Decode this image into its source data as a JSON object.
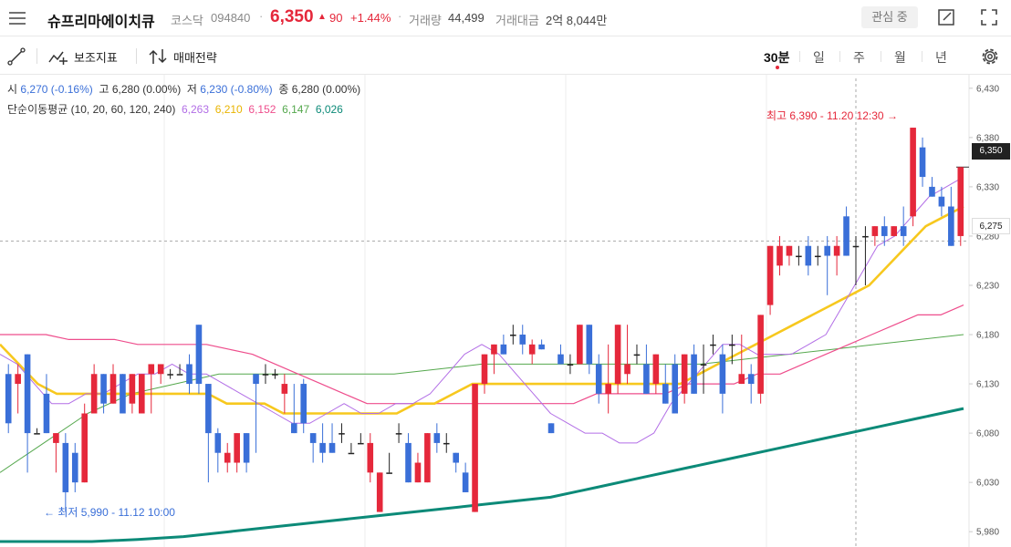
{
  "header": {
    "stock_name": "슈프리마에이치큐",
    "market": "코스닥",
    "code": "094840",
    "price": "6,350",
    "change_arrow": "▲",
    "change": "90",
    "change_pct": "+1.44%",
    "volume_label": "거래량",
    "volume": "44,499",
    "amount_label": "거래대금",
    "amount": "2억 8,044만",
    "watch_button": "관심 중"
  },
  "toolbar": {
    "indicator_label": "보조지표",
    "strategy_label": "매매전략",
    "periods": [
      "30분",
      "일",
      "주",
      "월",
      "년"
    ],
    "active_period": "30분"
  },
  "legend": {
    "open_label": "시",
    "open": "6,270 (-0.16%)",
    "high_label": "고",
    "high": "6,280 (0.00%)",
    "low_label": "저",
    "low": "6,230 (-0.80%)",
    "close_label": "종",
    "close": "6,280 (0.00%)",
    "ma_label": "단순이동평균 (10, 20, 60, 120, 240)",
    "ma10": "6,263",
    "ma20": "6,210",
    "ma60": "6,152",
    "ma120": "6,147",
    "ma240": "6,026"
  },
  "colors": {
    "up": "#e5283b",
    "down": "#3a6fd8",
    "ma10": "#b26ee6",
    "ma20": "#f7c81e",
    "ma60": "#ee4d8c",
    "ma120": "#55a84d",
    "ma240": "#0c8a78"
  },
  "annotations": {
    "high": "최고 6,390 - 11.20 12:30 →",
    "low": "← 최저 5,990 - 11.12 10:00"
  },
  "price_tags": {
    "current": "6,350",
    "crosshair": "6,275"
  },
  "chart_data": {
    "type": "candlestick",
    "y_axis_ticks": [
      "6,430",
      "6,380",
      "6,330",
      "6,280",
      "6,230",
      "6,180",
      "6,130",
      "6,080",
      "6,030",
      "5,980"
    ],
    "ylim": [
      5970,
      6440
    ],
    "candles": [
      {
        "o": 6140,
        "h": 6150,
        "l": 6080,
        "c": 6090
      },
      {
        "o": 6130,
        "h": 6150,
        "l": 6100,
        "c": 6140
      },
      {
        "o": 6160,
        "h": 6160,
        "l": 6040,
        "c": 6080
      },
      {
        "o": 6080,
        "h": 6085,
        "l": 6080,
        "c": 6080
      },
      {
        "o": 6120,
        "h": 6140,
        "l": 6080,
        "c": 6080
      },
      {
        "o": 6070,
        "h": 6080,
        "l": 6040,
        "c": 6080
      },
      {
        "o": 6070,
        "h": 6080,
        "l": 6000,
        "c": 6020
      },
      {
        "o": 6060,
        "h": 6070,
        "l": 6020,
        "c": 6030
      },
      {
        "o": 6030,
        "h": 6110,
        "l": 6030,
        "c": 6100
      },
      {
        "o": 6100,
        "h": 6150,
        "l": 6100,
        "c": 6140
      },
      {
        "o": 6140,
        "h": 6140,
        "l": 6100,
        "c": 6110
      },
      {
        "o": 6110,
        "h": 6150,
        "l": 6110,
        "c": 6140
      },
      {
        "o": 6140,
        "h": 6140,
        "l": 6100,
        "c": 6100
      },
      {
        "o": 6110,
        "h": 6140,
        "l": 6100,
        "c": 6140
      },
      {
        "o": 6100,
        "h": 6140,
        "l": 6100,
        "c": 6140
      },
      {
        "o": 6140,
        "h": 6150,
        "l": 6100,
        "c": 6150
      },
      {
        "o": 6140,
        "h": 6150,
        "l": 6130,
        "c": 6150
      },
      {
        "o": 6140,
        "h": 6145,
        "l": 6135,
        "c": 6140
      },
      {
        "o": 6140,
        "h": 6150,
        "l": 6140,
        "c": 6140
      },
      {
        "o": 6150,
        "h": 6160,
        "l": 6120,
        "c": 6130
      },
      {
        "o": 6190,
        "h": 6190,
        "l": 6120,
        "c": 6130
      },
      {
        "o": 6130,
        "h": 6130,
        "l": 6030,
        "c": 6080
      },
      {
        "o": 6080,
        "h": 6085,
        "l": 6040,
        "c": 6060
      },
      {
        "o": 6050,
        "h": 6070,
        "l": 6040,
        "c": 6060
      },
      {
        "o": 6050,
        "h": 6080,
        "l": 6040,
        "c": 6080
      },
      {
        "o": 6080,
        "h": 6080,
        "l": 6040,
        "c": 6050
      },
      {
        "o": 6140,
        "h": 6140,
        "l": 6060,
        "c": 6130
      },
      {
        "o": 6140,
        "h": 6150,
        "l": 6130,
        "c": 6140
      },
      {
        "o": 6140,
        "h": 6145,
        "l": 6135,
        "c": 6140
      },
      {
        "o": 6120,
        "h": 6140,
        "l": 6100,
        "c": 6130
      },
      {
        "o": 6090,
        "h": 6130,
        "l": 6080,
        "c": 6080
      },
      {
        "o": 6130,
        "h": 6135,
        "l": 6080,
        "c": 6090
      },
      {
        "o": 6080,
        "h": 6080,
        "l": 6050,
        "c": 6070
      },
      {
        "o": 6070,
        "h": 6090,
        "l": 6050,
        "c": 6060
      },
      {
        "o": 6070,
        "h": 6090,
        "l": 6060,
        "c": 6060
      },
      {
        "o": 6080,
        "h": 6090,
        "l": 6070,
        "c": 6080
      },
      {
        "o": 6060,
        "h": 6070,
        "l": 6060,
        "c": 6060
      },
      {
        "o": 6070,
        "h": 6080,
        "l": 6070,
        "c": 6070
      },
      {
        "o": 6040,
        "h": 6080,
        "l": 6030,
        "c": 6070
      },
      {
        "o": 6000,
        "h": 6040,
        "l": 6000,
        "c": 6040
      },
      {
        "o": 6040,
        "h": 6060,
        "l": 6040,
        "c": 6040
      },
      {
        "o": 6080,
        "h": 6090,
        "l": 6070,
        "c": 6080
      },
      {
        "o": 6070,
        "h": 6080,
        "l": 6030,
        "c": 6030
      },
      {
        "o": 6030,
        "h": 6060,
        "l": 6030,
        "c": 6050
      },
      {
        "o": 6030,
        "h": 6080,
        "l": 6030,
        "c": 6080
      },
      {
        "o": 6080,
        "h": 6090,
        "l": 6060,
        "c": 6070
      },
      {
        "o": 6070,
        "h": 6080,
        "l": 6060,
        "c": 6070
      },
      {
        "o": 6060,
        "h": 6060,
        "l": 6040,
        "c": 6050
      },
      {
        "o": 6040,
        "h": 6050,
        "l": 6020,
        "c": 6020
      },
      {
        "o": 6000,
        "h": 6130,
        "l": 6000,
        "c": 6130
      },
      {
        "o": 6130,
        "h": 6140,
        "l": 6120,
        "c": 6160
      },
      {
        "o": 6160,
        "h": 6160,
        "l": 6140,
        "c": 6170
      },
      {
        "o": 6170,
        "h": 6180,
        "l": 6160,
        "c": 6160
      },
      {
        "o": 6180,
        "h": 6190,
        "l": 6170,
        "c": 6180
      },
      {
        "o": 6180,
        "h": 6190,
        "l": 6160,
        "c": 6170
      },
      {
        "o": 6160,
        "h": 6175,
        "l": 6150,
        "c": 6170
      },
      {
        "o": 6170,
        "h": 6175,
        "l": 6165,
        "c": 6165
      },
      {
        "o": 6090,
        "h": 6090,
        "l": 6080,
        "c": 6080
      },
      {
        "o": 6160,
        "h": 6170,
        "l": 6150,
        "c": 6150
      },
      {
        "o": 6150,
        "h": 6160,
        "l": 6140,
        "c": 6150
      },
      {
        "o": 6150,
        "h": 6190,
        "l": 6150,
        "c": 6190
      },
      {
        "o": 6190,
        "h": 6190,
        "l": 6140,
        "c": 6150
      },
      {
        "o": 6150,
        "h": 6160,
        "l": 6110,
        "c": 6120
      },
      {
        "o": 6120,
        "h": 6170,
        "l": 6100,
        "c": 6130
      },
      {
        "o": 6130,
        "h": 6190,
        "l": 6120,
        "c": 6190
      },
      {
        "o": 6140,
        "h": 6190,
        "l": 6130,
        "c": 6150
      },
      {
        "o": 6160,
        "h": 6170,
        "l": 6150,
        "c": 6160
      },
      {
        "o": 6150,
        "h": 6170,
        "l": 6120,
        "c": 6120
      },
      {
        "o": 6130,
        "h": 6160,
        "l": 6120,
        "c": 6160
      },
      {
        "o": 6130,
        "h": 6150,
        "l": 6110,
        "c": 6110
      },
      {
        "o": 6150,
        "h": 6160,
        "l": 6100,
        "c": 6100
      },
      {
        "o": 6120,
        "h": 6160,
        "l": 6110,
        "c": 6160
      },
      {
        "o": 6160,
        "h": 6170,
        "l": 6120,
        "c": 6120
      },
      {
        "o": 6150,
        "h": 6170,
        "l": 6120,
        "c": 6150
      },
      {
        "o": 6170,
        "h": 6180,
        "l": 6160,
        "c": 6170
      },
      {
        "o": 6160,
        "h": 6170,
        "l": 6100,
        "c": 6120
      },
      {
        "o": 6170,
        "h": 6180,
        "l": 6150,
        "c": 6170
      },
      {
        "o": 6130,
        "h": 6180,
        "l": 6130,
        "c": 6140
      },
      {
        "o": 6140,
        "h": 6150,
        "l": 6110,
        "c": 6130
      },
      {
        "o": 6120,
        "h": 6200,
        "l": 6110,
        "c": 6200
      },
      {
        "o": 6210,
        "h": 6260,
        "l": 6200,
        "c": 6270
      },
      {
        "o": 6250,
        "h": 6280,
        "l": 6240,
        "c": 6270
      },
      {
        "o": 6260,
        "h": 6270,
        "l": 6250,
        "c": 6270
      },
      {
        "o": 6260,
        "h": 6270,
        "l": 6250,
        "c": 6260
      },
      {
        "o": 6270,
        "h": 6280,
        "l": 6240,
        "c": 6250
      },
      {
        "o": 6260,
        "h": 6270,
        "l": 6250,
        "c": 6260
      },
      {
        "o": 6270,
        "h": 6280,
        "l": 6220,
        "c": 6260
      },
      {
        "o": 6260,
        "h": 6280,
        "l": 6240,
        "c": 6270
      },
      {
        "o": 6300,
        "h": 6310,
        "l": 6260,
        "c": 6260
      },
      {
        "o": 6270,
        "h": 6280,
        "l": 6230,
        "c": 6270
      },
      {
        "o": 6280,
        "h": 6290,
        "l": 6230,
        "c": 6280
      },
      {
        "o": 6280,
        "h": 6290,
        "l": 6270,
        "c": 6290
      },
      {
        "o": 6290,
        "h": 6300,
        "l": 6270,
        "c": 6280
      },
      {
        "o": 6280,
        "h": 6290,
        "l": 6280,
        "c": 6290
      },
      {
        "o": 6290,
        "h": 6310,
        "l": 6270,
        "c": 6280
      },
      {
        "o": 6300,
        "h": 6390,
        "l": 6290,
        "c": 6390
      },
      {
        "o": 6370,
        "h": 6380,
        "l": 6330,
        "c": 6340
      },
      {
        "o": 6330,
        "h": 6340,
        "l": 6320,
        "c": 6320
      },
      {
        "o": 6320,
        "h": 6330,
        "l": 6300,
        "c": 6310
      },
      {
        "o": 6310,
        "h": 6330,
        "l": 6270,
        "c": 6270
      },
      {
        "o": 6280,
        "h": 6350,
        "l": 6270,
        "c": 6350
      }
    ],
    "ma10": [
      6160,
      6150,
      6130,
      6110,
      6110,
      6120,
      6120,
      6130,
      6140,
      6140,
      6150,
      6140,
      6140,
      6130,
      6120,
      6110,
      6100,
      6090,
      6090,
      6100,
      6110,
      6100,
      6100,
      6110,
      6110,
      6120,
      6140,
      6160,
      6170,
      6160,
      6140,
      6120,
      6100,
      6090,
      6080,
      6080,
      6070,
      6070,
      6080,
      6110,
      6130,
      6150,
      6170,
      6170,
      6160,
      6160,
      6160,
      6170,
      6180,
      6210,
      6240,
      6270,
      6280,
      6300,
      6320,
      6330,
      6340
    ],
    "ma20": [
      6170,
      6150,
      6130,
      6120,
      6120,
      6120,
      6120,
      6120,
      6120,
      6120,
      6120,
      6120,
      6110,
      6110,
      6110,
      6100,
      6100,
      6100,
      6100,
      6100,
      6100,
      6100,
      6110,
      6110,
      6120,
      6130,
      6130,
      6130,
      6130,
      6130,
      6130,
      6130,
      6130,
      6130,
      6130,
      6130,
      6130,
      6140,
      6150,
      6160,
      6170,
      6180,
      6190,
      6200,
      6210,
      6220,
      6230,
      6250,
      6270,
      6290,
      6300,
      6310
    ],
    "ma60": [
      6180,
      6180,
      6180,
      6175,
      6175,
      6175,
      6170,
      6170,
      6170,
      6170,
      6165,
      6160,
      6150,
      6140,
      6130,
      6120,
      6110,
      6110,
      6110,
      6110,
      6110,
      6110,
      6110,
      6110,
      6110,
      6110,
      6120,
      6120,
      6120,
      6120,
      6130,
      6130,
      6130,
      6140,
      6140,
      6150,
      6160,
      6170,
      6180,
      6190,
      6200,
      6200,
      6210
    ],
    "ma120": [
      6040,
      6070,
      6100,
      6120,
      6130,
      6140,
      6140,
      6140,
      6140,
      6140,
      6145,
      6150,
      6150,
      6150,
      6150,
      6150,
      6150,
      6155,
      6160,
      6165,
      6170,
      6175,
      6180
    ],
    "ma240": [
      5970,
      5970,
      5970,
      5972,
      5975,
      5980,
      5985,
      5990,
      5995,
      6000,
      6005,
      6010,
      6015,
      6025,
      6035,
      6045,
      6055,
      6065,
      6075,
      6085,
      6095,
      6105
    ]
  }
}
